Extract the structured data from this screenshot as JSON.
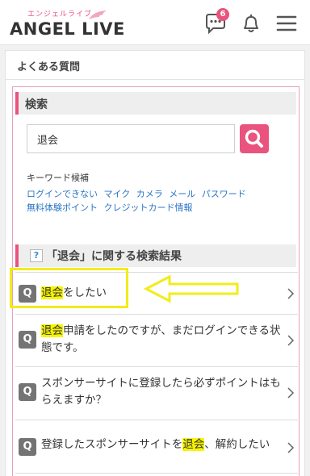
{
  "header": {
    "logo_sub": "エンジェルライブ",
    "logo_main": "ANGEL LIVE",
    "message_badge": "6",
    "icons": [
      "chat-bubble-icon",
      "bell-icon",
      "hamburger-menu-icon"
    ]
  },
  "page": {
    "title": "よくある質問"
  },
  "search": {
    "heading": "検索",
    "value": "退会",
    "button_icon": "search-icon"
  },
  "keywords": {
    "label": "キーワード候補",
    "row1": [
      "ログインできない",
      "マイク",
      "カメラ",
      "メール",
      "パスワード"
    ],
    "row2": [
      "無料体験ポイント",
      "クレジットカード情報"
    ]
  },
  "results": {
    "heading": "「退会」に関する検索結果",
    "badge": "Q",
    "items": [
      {
        "hl": "退会",
        "rest": "をしたい"
      },
      {
        "hl": "退会",
        "rest": "申請をしたのですが、まだログインできる状態です。"
      },
      {
        "pre": "スポンサーサイトに登録したら必ずポイントはもらえますか？"
      },
      {
        "pre": "登録したスポンサーサイトを",
        "hl": "退会",
        "rest": "、解約したい"
      }
    ]
  },
  "colors": {
    "accent": "#e9537d",
    "link": "#2b76c5",
    "highlight": "#f8f400",
    "annotation": "#f2ec1c"
  }
}
